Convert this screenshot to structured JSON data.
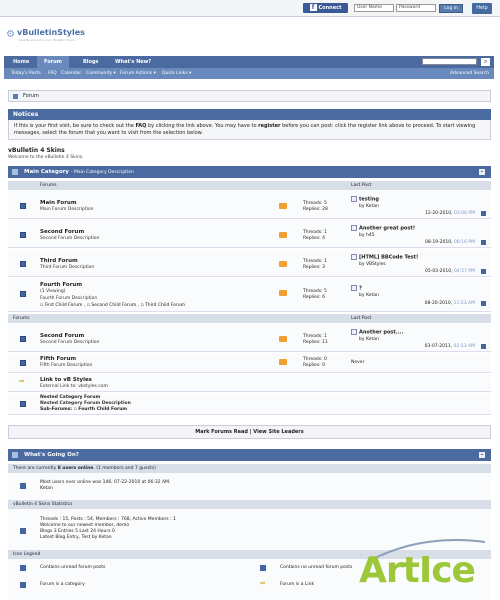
{
  "topbar": {
    "connect": "Connect",
    "username_placeholder": "User Name",
    "password_placeholder": "Password",
    "login": "Log in",
    "help": "Help"
  },
  "logo": {
    "name": "vBulletinStyles",
    "tagline": "Quality skins for your vBulletin forum"
  },
  "nav": {
    "tabs": [
      "Home",
      "Forum",
      "Blogs",
      "What's New?"
    ],
    "sub": [
      "Today's Posts",
      "FAQ",
      "Calendar",
      "Community ▾",
      "Forum Actions ▾",
      "Quick Links ▾"
    ],
    "advanced": "Advanced Search"
  },
  "breadcrumb": "Forum",
  "notices": {
    "title": "Notices",
    "text1": "If this is your first visit, be sure to check out the ",
    "faq": "FAQ",
    "text2": " by clicking the link above. You may have to ",
    "register": "register",
    "text3": " before you can post: click the register link above to proceed. To start viewing messages, select the forum that you want to visit from the selection below."
  },
  "page": {
    "title": "vBulletin 4 Skins",
    "subtitle": "Welcome to the vBulletin 4 Skins."
  },
  "main_category": {
    "title": "Main Category",
    "desc": "- Main Category Description",
    "col_forums": "Forums",
    "col_last": "Last Post"
  },
  "forums": [
    {
      "title": "Main Forum",
      "desc": "Main Forum Description",
      "threads": "Threads: 5",
      "replies": "Replies: 28",
      "lp_title": "testing",
      "lp_by": "by Ketan",
      "lp_date": "12-20-2010,",
      "lp_time": "03:06 PM"
    },
    {
      "title": "Second Forum",
      "desc": "Second Forum Description",
      "threads": "Threads: 1",
      "replies": "Replies: 4",
      "lp_title": "Another great post!",
      "lp_by": "by h45",
      "lp_date": "08-19-2010,",
      "lp_time": "08:16 PM"
    },
    {
      "title": "Third Forum",
      "desc": "Third Forum Description",
      "threads": "Threads: 1",
      "replies": "Replies: 3",
      "lp_title": "[HTML] BBCode Test!",
      "lp_by": "by VBStyles",
      "lp_date": "05-03-2010,",
      "lp_time": "04:57 PM"
    },
    {
      "title": "Fourth Forum",
      "viewing": "(1 Viewing)",
      "desc": "Fourth Forum Description",
      "subs": [
        "First Child Forum",
        "Second Child Forum",
        "Third Child Forum"
      ],
      "threads": "Threads: 5",
      "replies": "Replies: 6",
      "lp_title": "?",
      "lp_by": "by Ketan",
      "lp_date": "08-20-2010,",
      "lp_time": "11:23 AM"
    }
  ],
  "forums2": [
    {
      "title": "Second Forum",
      "desc": "Second Forum Description",
      "threads": "Threads: 1",
      "replies": "Replies: 11",
      "lp_title": "Another post....",
      "lp_by": "by Ketan",
      "lp_date": "03-07-2011,",
      "lp_time": "02:13 AM"
    },
    {
      "title": "Fifth Forum",
      "desc": "Fifth Forum Description",
      "threads": "Threads: 0",
      "replies": "Replies: 0",
      "never": "Never"
    }
  ],
  "link": {
    "title": "Link to vB Styles",
    "desc": "External Link to: vbstyles.com"
  },
  "nested": {
    "title": "Nested Category Forum",
    "desc": "Nested Category Forum Description",
    "subs_label": "Sub-Forums:",
    "sub": "Fourth Child Forum"
  },
  "mark": {
    "a": "Mark Forums Read",
    "sep": "|",
    "b": "View Site Leaders"
  },
  "going_on": {
    "title": "What's Going On?",
    "online_a": "There are currently ",
    "online_count": "8 users online",
    "online_b": ". (1 members and 7 guests)",
    "most": "Most users ever online was 146, 07-22-2010 at 06:32 AM.",
    "members": "Ketan",
    "stats_title": "vBulletin 4 Skins Statistics",
    "stats1": "Threads : 15, Posts : 54, Members : 768, Active Members : 1",
    "stats2": "Welcome to our newest member, demo",
    "stats3": "Blogs 3   Entries 5   Last 24 Hours 0",
    "stats4": "Latest Blog Entry, Test by Ketan",
    "legend_title": "Icon Legend",
    "leg1": "Contains unread forum posts",
    "leg2": "Contains no unread forum posts",
    "leg3": "Forum is a category",
    "leg4": "Forum is a Link"
  },
  "watermark": "ArtIce"
}
